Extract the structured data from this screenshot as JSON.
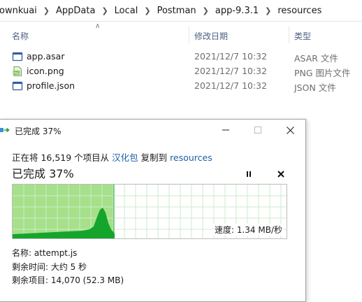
{
  "breadcrumb": [
    "ownkuai",
    "AppData",
    "Local",
    "Postman",
    "app-9.3.1",
    "resources"
  ],
  "columns": {
    "name": "名称",
    "date": "修改日期",
    "type": "类型"
  },
  "files": [
    {
      "name": "app.asar",
      "date": "2021/12/7 10:32",
      "type": "ASAR 文件",
      "icon": "file-icon"
    },
    {
      "name": "icon.png",
      "date": "2021/12/7 10:32",
      "type": "PNG 图片文件",
      "icon": "image-file-icon"
    },
    {
      "name": "profile.json",
      "date": "2021/12/7 10:32",
      "type": "JSON 文件",
      "icon": "file-icon"
    }
  ],
  "dialog": {
    "title": "已完成 37%",
    "copy_prefix": "正在将 16,519 个项目从",
    "source": "汉化包",
    "copy_mid": "复制到",
    "destination": "resources",
    "progress_text": "已完成 37%",
    "percent_complete": 37,
    "speed": "速度: 1.34 MB/秒",
    "name_line": "名称: attempt.js",
    "time_line": "剩余时间: 大约 5 秒",
    "items_line": "剩余项目: 14,070 (52.3 MB)"
  },
  "colors": {
    "progress_fill": "#a6e08a",
    "throughput": "#16a52c",
    "link": "#1a5fa8"
  }
}
